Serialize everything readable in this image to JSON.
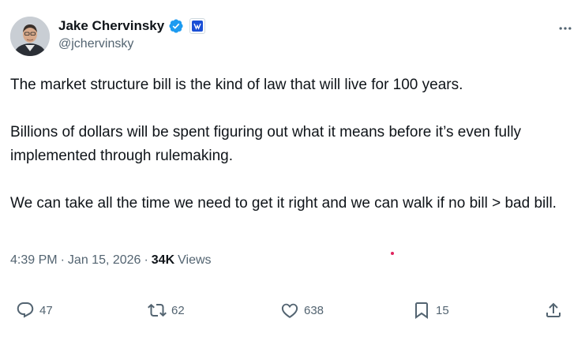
{
  "author": {
    "name": "Jake Chervinsky",
    "handle": "@jchervinsky"
  },
  "tweet": {
    "paragraphs": [
      "The market structure bill is the kind of law that will live for 100 years.",
      "Billions of dollars will be spent figuring out what it means before it’s even fully implemented through rulemaking.",
      "We can take all the time we need to get it right and we can walk if no bill > bad bill."
    ]
  },
  "meta": {
    "time": "4:39 PM",
    "separator": "·",
    "date": "Jan 15, 2026",
    "separator2": "·",
    "views_count": "34K",
    "views_label": "Views"
  },
  "actions": {
    "replies": "47",
    "reposts": "62",
    "likes": "638",
    "bookmarks": "15"
  },
  "icons": {
    "verified": "verified-badge-icon",
    "affiliate": "affiliate-badge-icon",
    "more": "more-icon",
    "reply": "reply-icon",
    "repost": "repost-icon",
    "like": "heart-icon",
    "bookmark": "bookmark-icon",
    "share": "share-icon"
  },
  "colors": {
    "text": "#0f1419",
    "secondary": "#536471",
    "verified": "#1d9bf0"
  }
}
